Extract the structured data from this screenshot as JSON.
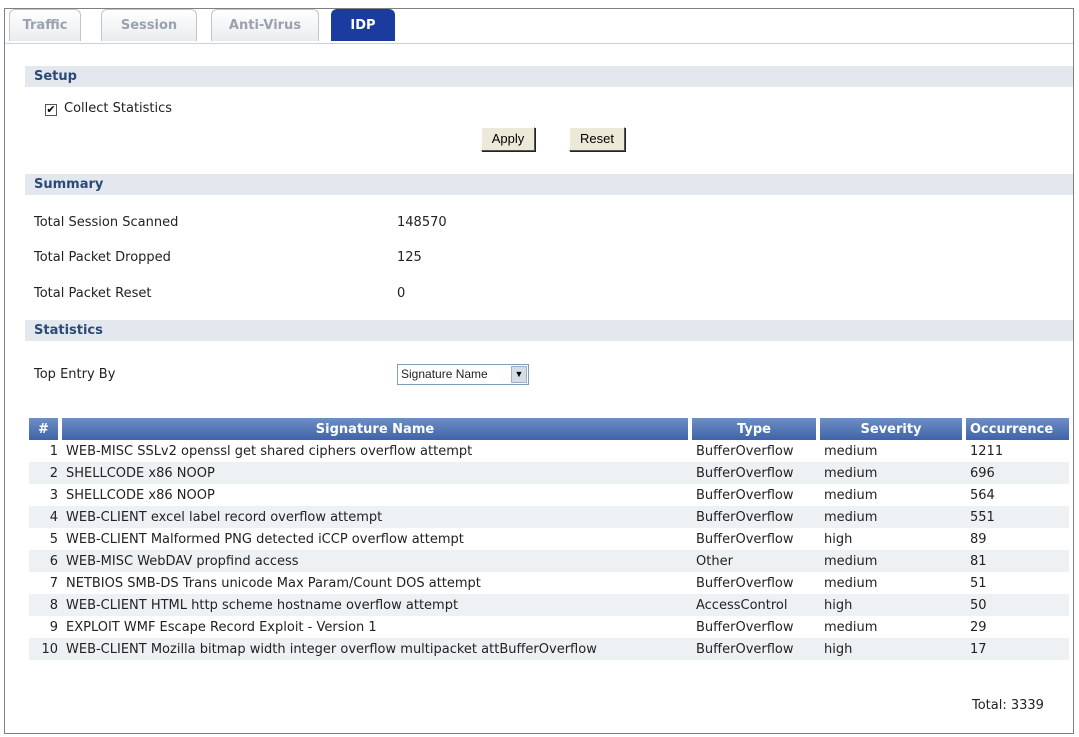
{
  "tabs": [
    {
      "label": "Traffic",
      "active": false
    },
    {
      "label": "Session",
      "active": false
    },
    {
      "label": "Anti-Virus",
      "active": false
    },
    {
      "label": "IDP",
      "active": true
    }
  ],
  "setup": {
    "section_title": "Setup",
    "collect_statistics_label": "Collect Statistics",
    "collect_statistics_checked": true,
    "apply_label": "Apply",
    "reset_label": "Reset"
  },
  "summary": {
    "section_title": "Summary",
    "rows": [
      {
        "label": "Total Session Scanned",
        "value": "148570"
      },
      {
        "label": "Total Packet Dropped",
        "value": "125"
      },
      {
        "label": "Total Packet Reset",
        "value": "0"
      }
    ]
  },
  "statistics": {
    "section_title": "Statistics",
    "top_entry_label": "Top Entry By",
    "top_entry_value": "Signature Name",
    "columns": [
      "#",
      "Signature Name",
      "Type",
      "Severity",
      "Occurrence"
    ],
    "rows": [
      {
        "n": "1",
        "name": "WEB-MISC SSLv2 openssl get shared ciphers overflow attempt",
        "type": "BufferOverflow",
        "severity": "medium",
        "occurrence": "1211"
      },
      {
        "n": "2",
        "name": "SHELLCODE x86 NOOP",
        "type": "BufferOverflow",
        "severity": "medium",
        "occurrence": "696"
      },
      {
        "n": "3",
        "name": "SHELLCODE x86 NOOP",
        "type": "BufferOverflow",
        "severity": "medium",
        "occurrence": "564"
      },
      {
        "n": "4",
        "name": "WEB-CLIENT excel label record overflow attempt",
        "type": "BufferOverflow",
        "severity": "medium",
        "occurrence": "551"
      },
      {
        "n": "5",
        "name": "WEB-CLIENT Malformed PNG detected iCCP overflow attempt",
        "type": "BufferOverflow",
        "severity": "high",
        "occurrence": "89"
      },
      {
        "n": "6",
        "name": "WEB-MISC WebDAV propfind access",
        "type": "Other",
        "severity": "medium",
        "occurrence": "81"
      },
      {
        "n": "7",
        "name": "NETBIOS SMB-DS Trans unicode Max Param/Count DOS attempt",
        "type": "BufferOverflow",
        "severity": "medium",
        "occurrence": "51"
      },
      {
        "n": "8",
        "name": "WEB-CLIENT HTML http scheme hostname overflow attempt",
        "type": "AccessControl",
        "severity": "high",
        "occurrence": "50"
      },
      {
        "n": "9",
        "name": "EXPLOIT WMF Escape Record Exploit - Version 1",
        "type": "BufferOverflow",
        "severity": "medium",
        "occurrence": "29"
      },
      {
        "n": "10",
        "name": "WEB-CLIENT Mozilla bitmap width integer overflow multipacket attBufferOverflow",
        "type": "BufferOverflow",
        "severity": "high",
        "occurrence": "17"
      }
    ],
    "total": "Total:  3339"
  }
}
